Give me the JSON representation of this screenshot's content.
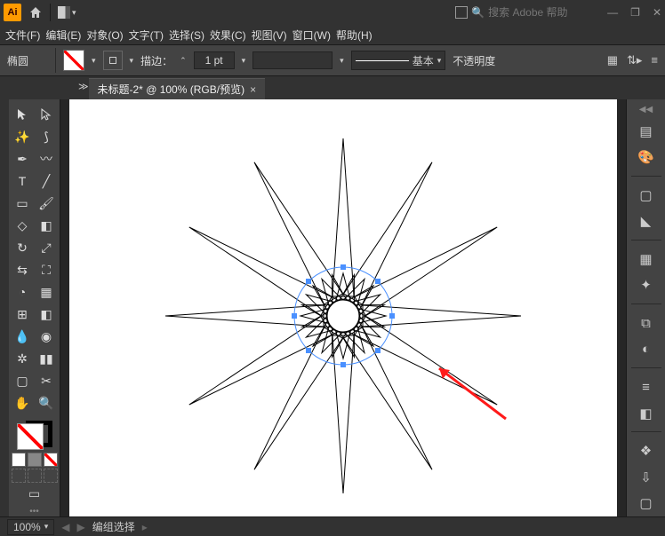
{
  "titlebar": {
    "logo": "Ai",
    "search_placeholder": "搜索 Adobe 帮助",
    "win_min": "—",
    "win_restore": "❐",
    "win_close": "✕"
  },
  "menubar": {
    "file": "文件(F)",
    "edit": "编辑(E)",
    "object": "对象(O)",
    "type": "文字(T)",
    "select": "选择(S)",
    "effect": "效果(C)",
    "view": "视图(V)",
    "window": "窗口(W)",
    "help": "帮助(H)"
  },
  "controlbar": {
    "shape": "椭圆",
    "stroke_label": "描边：",
    "stroke_val": "1 pt",
    "brush_label": "基本",
    "opacity_label": "不透明度"
  },
  "tab": {
    "title": "未标题-2* @ 100% (RGB/预览)",
    "close": "×",
    "expand": "≫"
  },
  "statusbar": {
    "zoom": "100%",
    "selection": "编组选择"
  }
}
